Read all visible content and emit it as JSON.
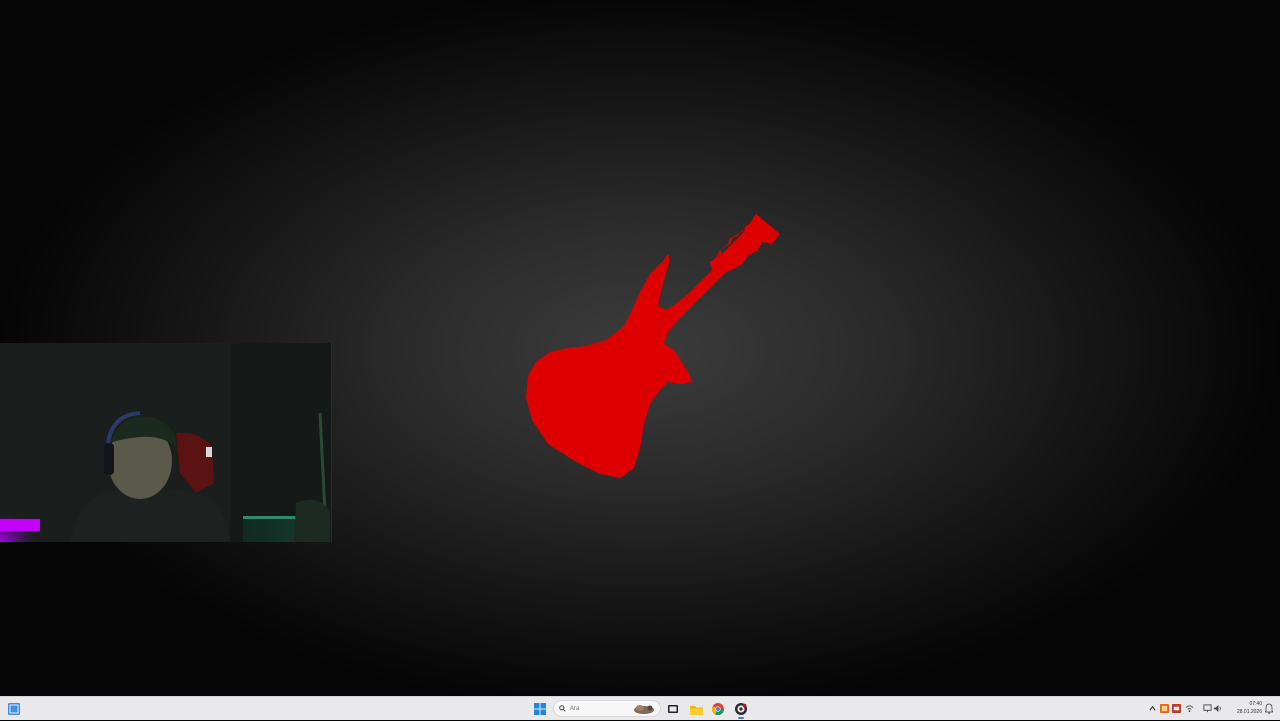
{
  "desktop": {
    "logo": {
      "icon": "guitar-icon",
      "color": "#dd0000"
    },
    "webcam_overlay": {
      "label": "webcam-feed"
    }
  },
  "taskbar": {
    "start_icon_left": "windows-icon",
    "start_icon_center": "windows-start-icon",
    "search": {
      "placeholder": "Ara",
      "icon": "search-icon"
    },
    "pinned": [
      {
        "name": "widget-icon"
      },
      {
        "name": "task-view-icon"
      },
      {
        "name": "file-explorer-icon"
      },
      {
        "name": "chrome-icon"
      },
      {
        "name": "obs-icon"
      }
    ],
    "tray": {
      "icons": [
        "chevron-up-icon",
        "app-tray-icon",
        "app-tray-icon-2",
        "network-icon",
        "display-icon",
        "volume-icon"
      ],
      "time": "07:40",
      "date": "28.01.2026"
    },
    "accent": "#4f7bd8"
  }
}
